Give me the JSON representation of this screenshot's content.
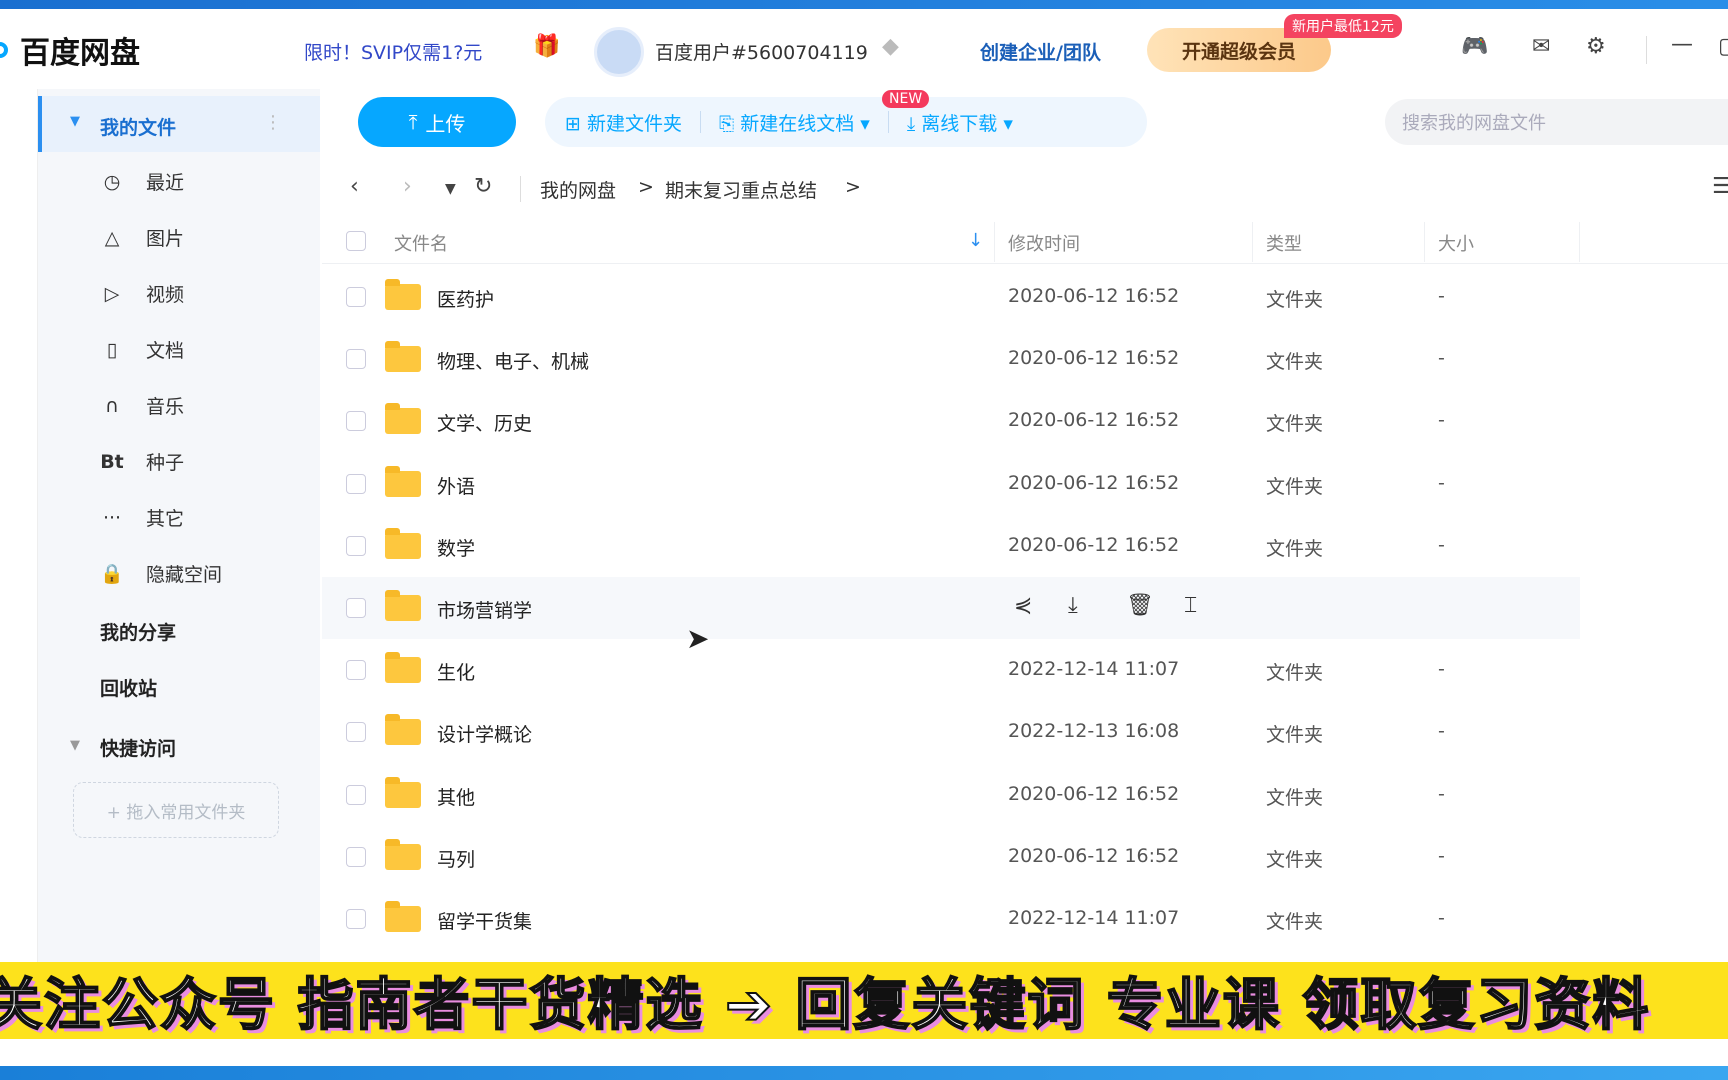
{
  "app": {
    "title": "百度网盘",
    "promo": "限时！SVIP仅需1?元",
    "user": "百度用户#5600704119",
    "enterprise": "创建企业/团队",
    "vip_button": "开通超级会员",
    "vip_badge": "新用户最低12元"
  },
  "sidebar": {
    "my_files": "我的文件",
    "items": [
      {
        "icon": "clock-icon",
        "glyph": "◷",
        "label": "最近"
      },
      {
        "icon": "image-icon",
        "glyph": "△",
        "label": "图片"
      },
      {
        "icon": "play-icon",
        "glyph": "▷",
        "label": "视频"
      },
      {
        "icon": "document-icon",
        "glyph": "▯",
        "label": "文档"
      },
      {
        "icon": "headphones-icon",
        "glyph": "∩",
        "label": "音乐"
      },
      {
        "icon": "bt-icon",
        "glyph": "Bt",
        "label": "种子"
      },
      {
        "icon": "more-icon",
        "glyph": "···",
        "label": "其它"
      },
      {
        "icon": "lock-icon",
        "glyph": "🔒",
        "label": "隐藏空间"
      }
    ],
    "my_share": "我的分享",
    "recycle": "回收站",
    "quick_access": "快捷访问",
    "drop_hint": "+ 拖入常用文件夹"
  },
  "toolbar": {
    "upload": "上传",
    "new_folder": "新建文件夹",
    "new_doc": "新建在线文档",
    "new_badge": "NEW",
    "offline": "离线下载",
    "search_placeholder": "搜索我的网盘文件"
  },
  "breadcrumb": [
    "我的网盘",
    "期末复习重点总结"
  ],
  "table": {
    "headers": {
      "name": "文件名",
      "modified": "修改时间",
      "type": "类型",
      "size": "大小"
    },
    "rows": [
      {
        "name": "医药护",
        "modified": "2020-06-12 16:52",
        "type": "文件夹",
        "size": "-"
      },
      {
        "name": "物理、电子、机械",
        "modified": "2020-06-12 16:52",
        "type": "文件夹",
        "size": "-"
      },
      {
        "name": "文学、历史",
        "modified": "2020-06-12 16:52",
        "type": "文件夹",
        "size": "-"
      },
      {
        "name": "外语",
        "modified": "2020-06-12 16:52",
        "type": "文件夹",
        "size": "-"
      },
      {
        "name": "数学",
        "modified": "2020-06-12 16:52",
        "type": "文件夹",
        "size": "-"
      },
      {
        "name": "市场营销学",
        "modified": "",
        "type": "",
        "size": "",
        "hovered": true
      },
      {
        "name": "生化",
        "modified": "2022-12-14 11:07",
        "type": "文件夹",
        "size": "-"
      },
      {
        "name": "设计学概论",
        "modified": "2022-12-13 16:08",
        "type": "文件夹",
        "size": "-"
      },
      {
        "name": "其他",
        "modified": "2020-06-12 16:52",
        "type": "文件夹",
        "size": "-"
      },
      {
        "name": "马列",
        "modified": "2020-06-12 16:52",
        "type": "文件夹",
        "size": "-"
      },
      {
        "name": "留学干货集",
        "modified": "2022-12-14 11:07",
        "type": "文件夹",
        "size": "-"
      }
    ]
  },
  "banner": "关注公众号  指南者干货精选 ➔ 回复关键词  专业课  领取复习资料",
  "colors": {
    "accent": "#06a7ff",
    "banner": "#fde21c",
    "folder": "#fdc73e"
  }
}
